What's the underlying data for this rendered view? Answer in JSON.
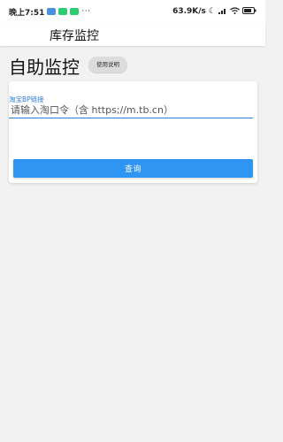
{
  "status_bar": {
    "time": "晚上7:51",
    "dots": "···",
    "speed": "63.9K/s",
    "icons": [
      "moon-icon",
      "signal-icon",
      "wifi-icon",
      "battery-icon"
    ]
  },
  "app_bar": {
    "title": "库存监控"
  },
  "header": {
    "title": "自助监控",
    "help_label": "使用说明"
  },
  "form": {
    "field_label": "淘宝BP链接",
    "field_placeholder": "请输入淘口令（含 https;//m.tb.cn）",
    "query_label": "查询"
  },
  "colors": {
    "accent": "#2f7ae5",
    "button": "#2f95f2"
  }
}
